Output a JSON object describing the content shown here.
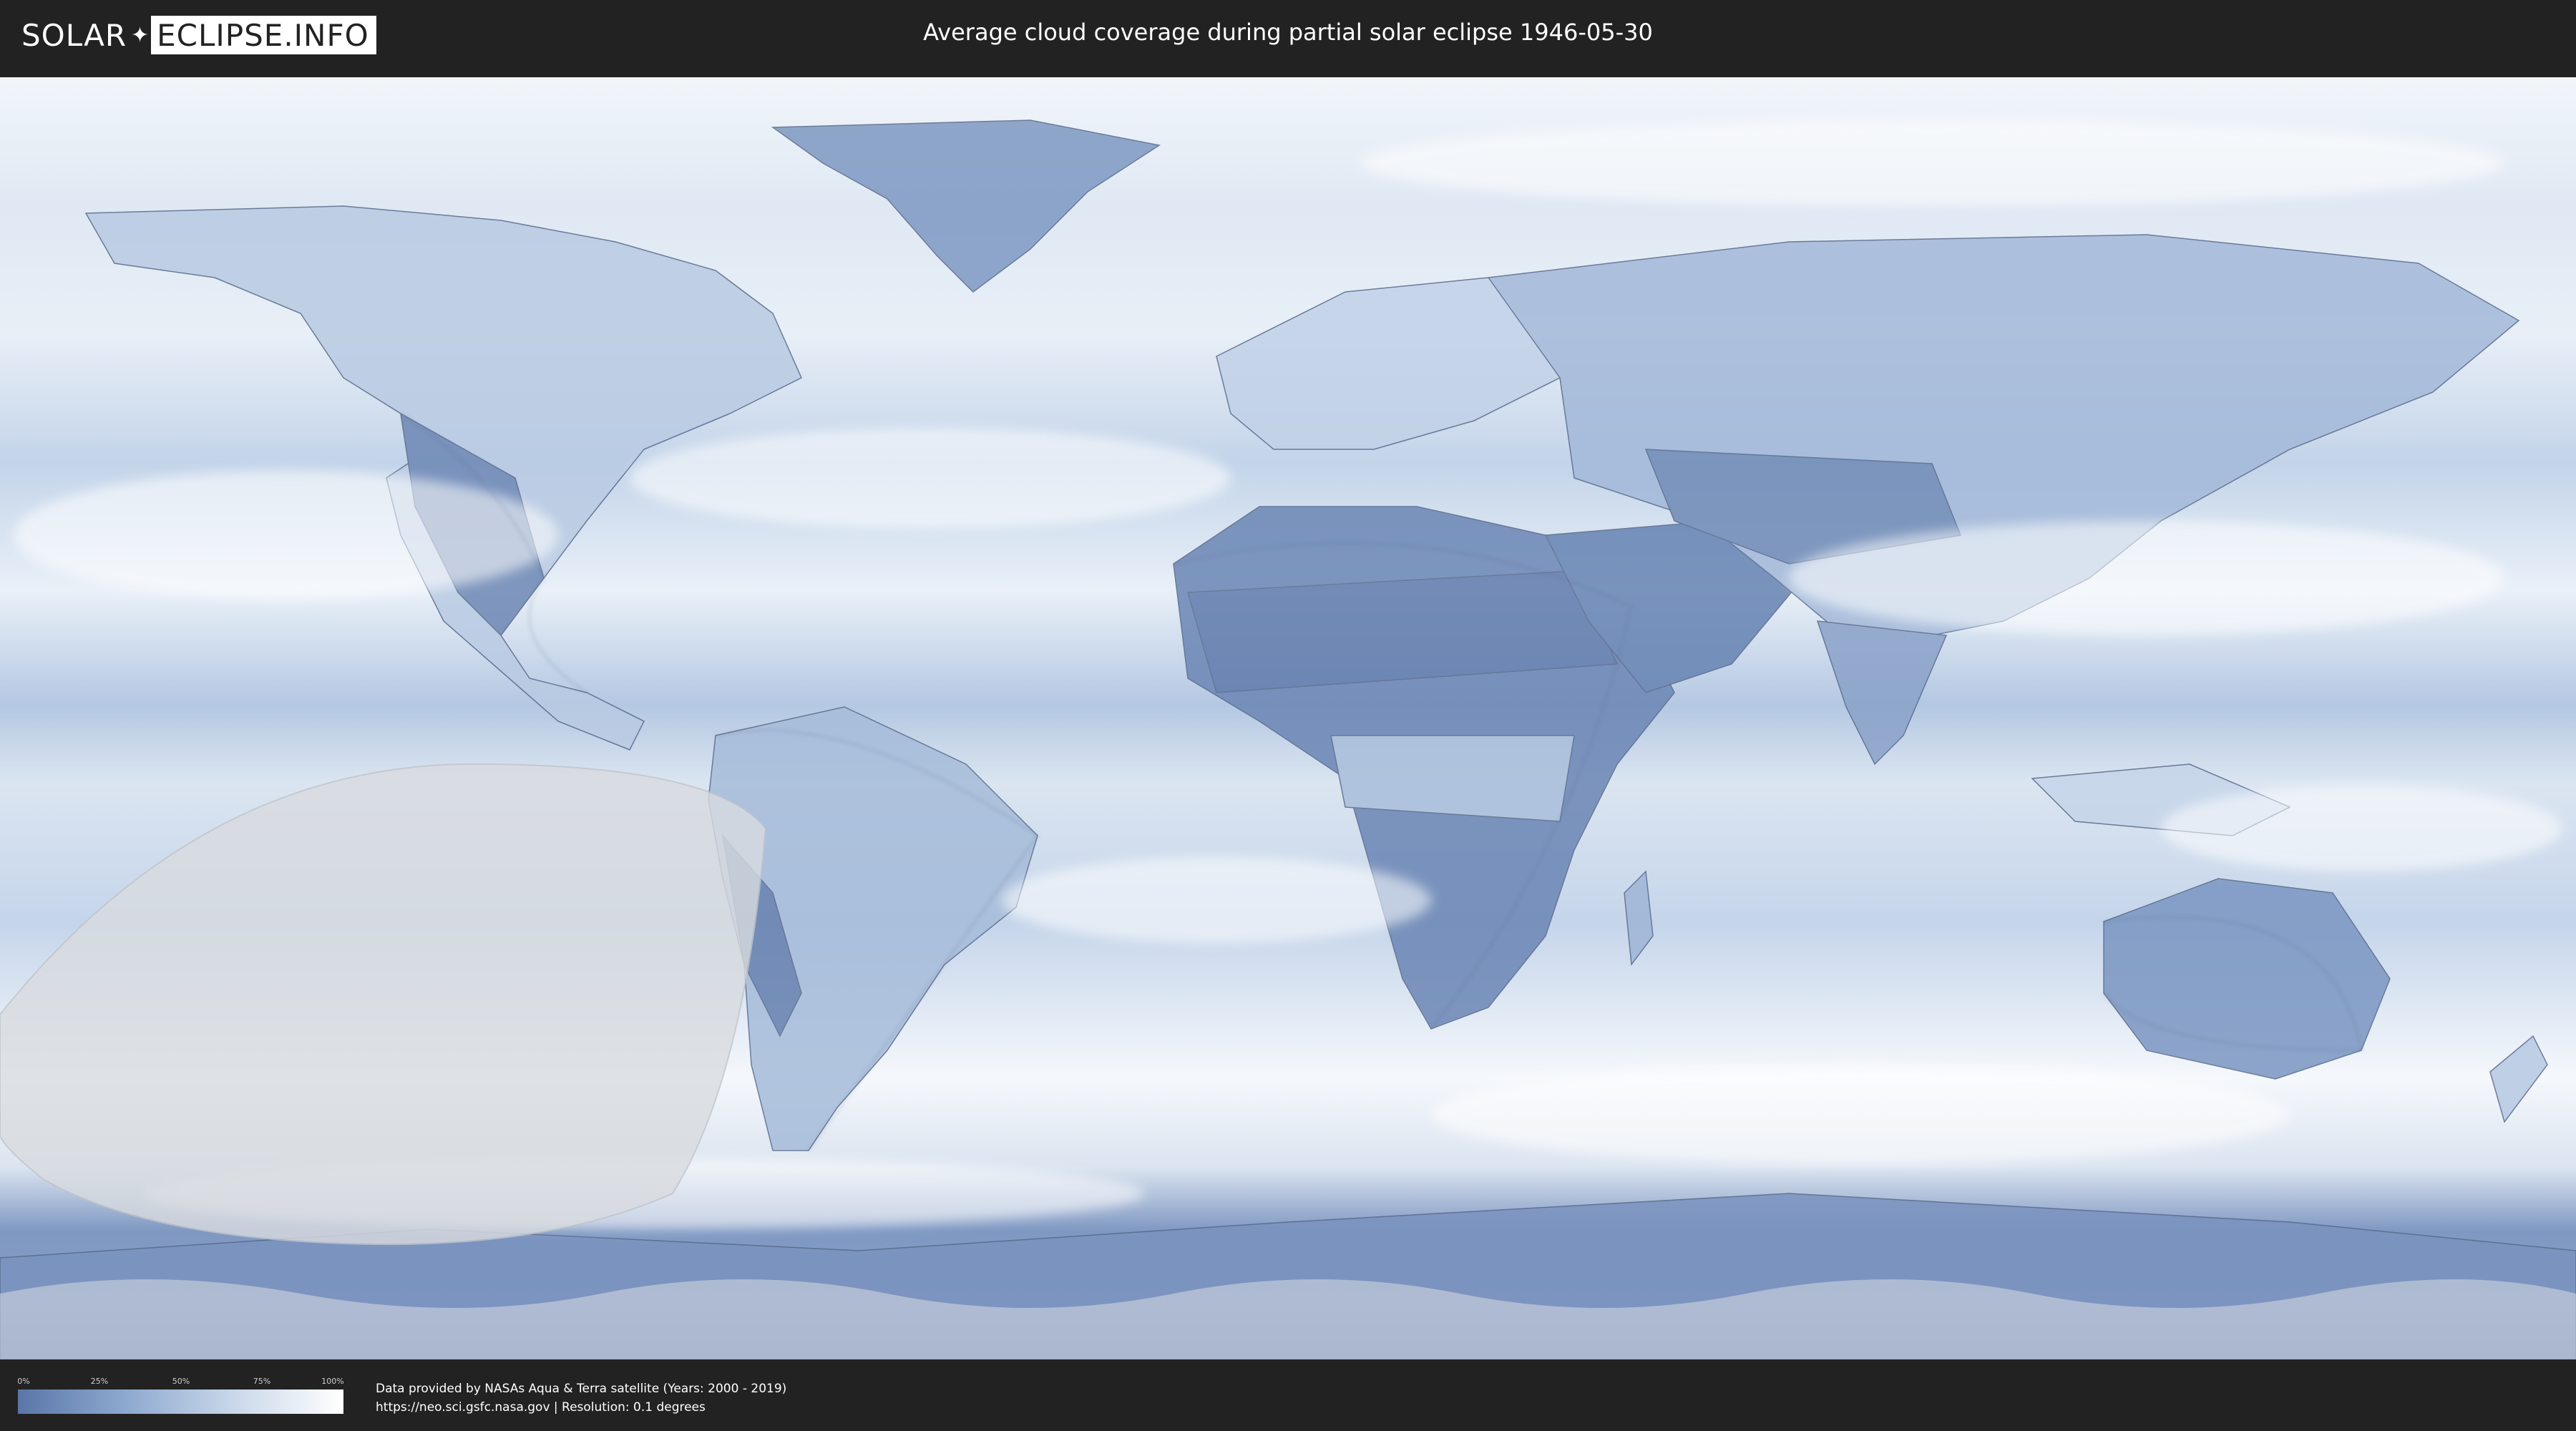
{
  "header": {
    "logo_solar": "SOLAR",
    "logo_eclipse": "ECLIPSE.INFO",
    "title": "Average cloud coverage during partial solar eclipse 1946-05-30"
  },
  "legend": {
    "ticks": [
      "0%",
      "25%",
      "50%",
      "75%",
      "100%"
    ],
    "gradient_colors": [
      "#5a76a8",
      "#8ea9cf",
      "#c9d8ea",
      "#ffffff"
    ]
  },
  "credits": {
    "line1": "Data provided by NASAs Aqua & Terra satellite (Years: 2000 - 2019)",
    "line2": "https://neo.sci.gsfc.nasa.gov | Resolution: 0.1 degrees"
  },
  "map": {
    "land_color": "#6f89b5",
    "cloud_color": "#eef3fa",
    "ocean_band_color": "#b4c8e2",
    "eclipse_shadow_color": "#d9dce0",
    "icons": [
      "world-map",
      "eclipse-visibility-region"
    ]
  }
}
